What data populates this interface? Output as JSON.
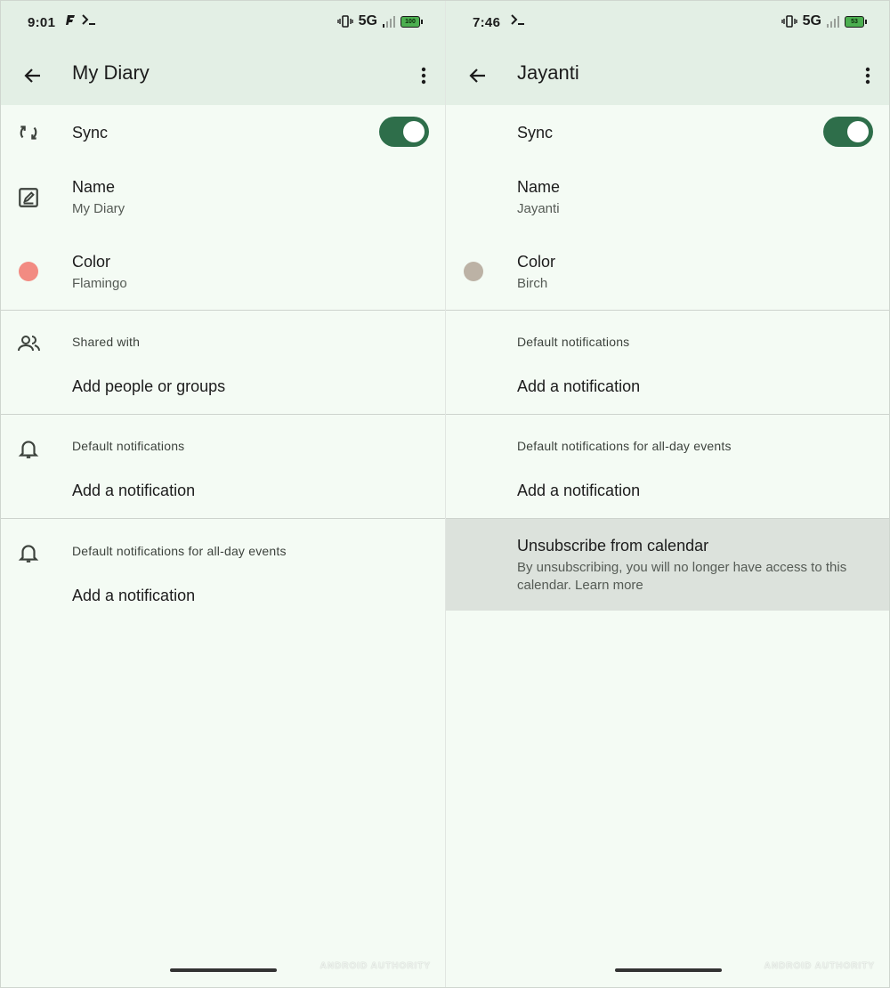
{
  "left": {
    "status": {
      "time": "9:01",
      "network": "5G",
      "battery": "100"
    },
    "appbar": {
      "title": "My Diary"
    },
    "sync": {
      "label": "Sync",
      "on": true
    },
    "name": {
      "label": "Name",
      "value": "My Diary"
    },
    "color": {
      "label": "Color",
      "value": "Flamingo",
      "swatch": "#f28b82"
    },
    "shared": {
      "label": "Shared with",
      "action": "Add people or groups"
    },
    "notifications": {
      "label": "Default notifications",
      "action": "Add a notification"
    },
    "allday": {
      "label": "Default notifications for all-day events",
      "action": "Add a notification"
    },
    "watermark": "ANDROID AUTHORITY"
  },
  "right": {
    "status": {
      "time": "7:46",
      "network": "5G",
      "battery": "53"
    },
    "appbar": {
      "title": "Jayanti"
    },
    "sync": {
      "label": "Sync",
      "on": true
    },
    "name": {
      "label": "Name",
      "value": "Jayanti"
    },
    "color": {
      "label": "Color",
      "value": "Birch",
      "swatch": "#bcb2a5"
    },
    "notifications": {
      "label": "Default notifications",
      "action": "Add a notification"
    },
    "allday": {
      "label": "Default notifications for all-day events",
      "action": "Add a notification"
    },
    "unsubscribe": {
      "title": "Unsubscribe from calendar",
      "body": "By unsubscribing, you will no longer have access to this calendar. Learn more"
    },
    "watermark": "ANDROID AUTHORITY"
  },
  "colors": {
    "accent": "#2e6e4a",
    "appbar_bg": "#e3efe5",
    "page_bg": "#f4fbf4"
  }
}
